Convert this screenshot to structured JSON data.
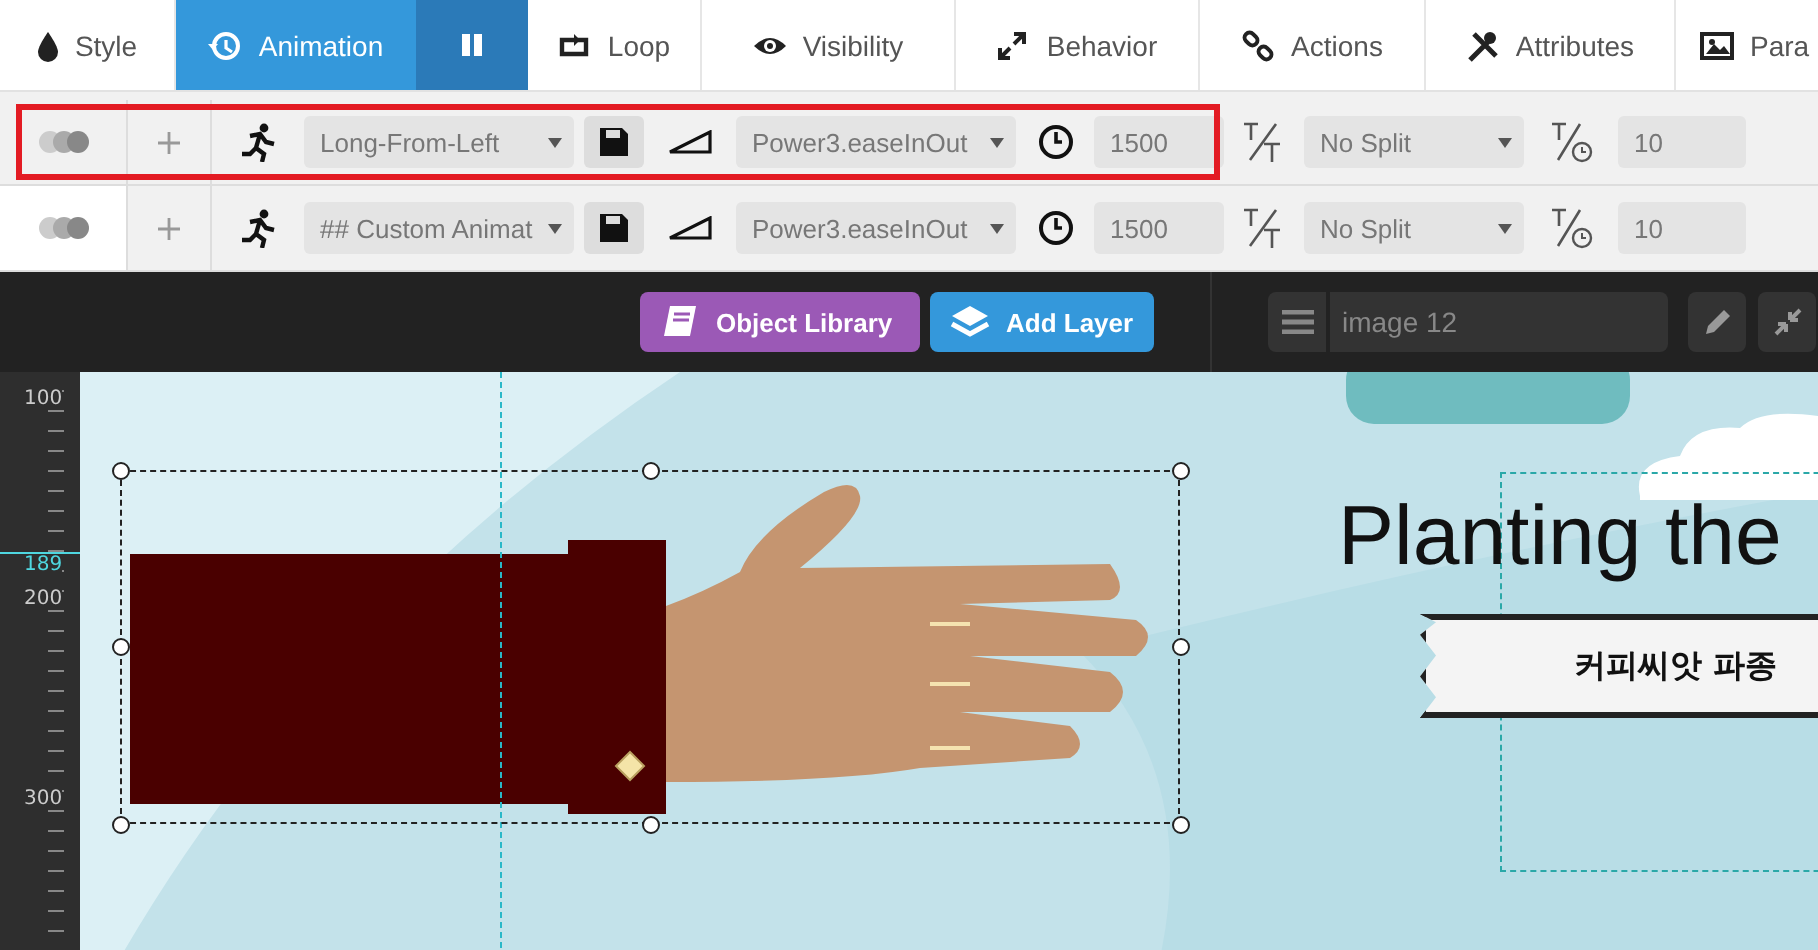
{
  "tabs": [
    {
      "label": "Style",
      "selected": false
    },
    {
      "label": "Animation",
      "selected": true
    },
    {
      "label": "Loop",
      "selected": false
    },
    {
      "label": "Visibility",
      "selected": false
    },
    {
      "label": "Behavior",
      "selected": false
    },
    {
      "label": "Actions",
      "selected": false
    },
    {
      "label": "Attributes",
      "selected": false
    },
    {
      "label": "Para",
      "selected": false
    }
  ],
  "animation_rows": [
    {
      "selected": true,
      "highlighted": true,
      "animation": "Long-From-Left",
      "easing": "Power3.easeInOut",
      "duration": "1500",
      "split": "No Split",
      "split_delay": "10"
    },
    {
      "selected": false,
      "highlighted": false,
      "animation": "## Custom Animat",
      "easing": "Power3.easeInOut",
      "duration": "1500",
      "split": "No Split",
      "split_delay": "10"
    }
  ],
  "toolbar": {
    "object_library": "Object Library",
    "add_layer": "Add Layer",
    "layer_name": "image 12"
  },
  "ruler": {
    "labels": [
      {
        "text": "100",
        "kind": "tick"
      },
      {
        "text": "189",
        "kind": "marker"
      },
      {
        "text": "200",
        "kind": "tick"
      },
      {
        "text": "300",
        "kind": "tick"
      }
    ]
  },
  "canvas": {
    "title": "Planting the",
    "banner": "커피씨앗 파종"
  }
}
